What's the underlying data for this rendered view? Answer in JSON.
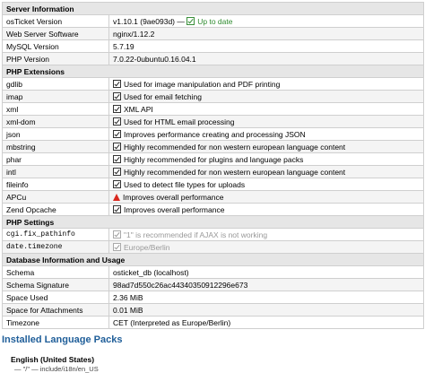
{
  "server": {
    "header": "Server Information",
    "rows": [
      {
        "label": "osTicket Version",
        "value": "v1.10.1 (9ae093d) —",
        "status": "Up to date"
      },
      {
        "label": "Web Server Software",
        "value": "nginx/1.12.2"
      },
      {
        "label": "MySQL Version",
        "value": "5.7.19"
      },
      {
        "label": "PHP Version",
        "value": "7.0.22-0ubuntu0.16.04.1"
      }
    ]
  },
  "extensions": {
    "header": "PHP Extensions",
    "rows": [
      {
        "label": "gdlib",
        "icon": "check",
        "value": "Used for image manipulation and PDF printing"
      },
      {
        "label": "imap",
        "icon": "check",
        "value": "Used for email fetching"
      },
      {
        "label": "xml",
        "icon": "check",
        "value": "XML API"
      },
      {
        "label": "xml-dom",
        "icon": "check",
        "value": "Used for HTML email processing"
      },
      {
        "label": "json",
        "icon": "check",
        "value": "Improves performance creating and processing JSON"
      },
      {
        "label": "mbstring",
        "icon": "check",
        "value": "Highly recommended for non western european language content"
      },
      {
        "label": "phar",
        "icon": "check",
        "value": "Highly recommended for plugins and language packs"
      },
      {
        "label": "intl",
        "icon": "check",
        "value": "Highly recommended for non western european language content"
      },
      {
        "label": "fileinfo",
        "icon": "check",
        "value": "Used to detect file types for uploads"
      },
      {
        "label": "APCu",
        "icon": "warning",
        "value": "Improves overall performance"
      },
      {
        "label": "Zend Opcache",
        "icon": "check",
        "value": "Improves overall performance"
      }
    ]
  },
  "settings": {
    "header": "PHP Settings",
    "rows": [
      {
        "label": "cgi.fix_pathinfo",
        "value": "\"1\" is recommended if AJAX is not working"
      },
      {
        "label": "date.timezone",
        "value": "Europe/Berlin"
      }
    ]
  },
  "database": {
    "header": "Database Information and Usage",
    "rows": [
      {
        "label": "Schema",
        "value": "osticket_db (localhost)"
      },
      {
        "label": "Schema Signature",
        "value": "98ad7d550c26ac44340350912296e673"
      },
      {
        "label": "Space Used",
        "value": "2.36 MiB"
      },
      {
        "label": "Space for Attachments",
        "value": "0.01 MiB"
      },
      {
        "label": "Timezone",
        "value": "CET (Interpreted as Europe/Berlin)"
      }
    ]
  },
  "language_packs": {
    "title": "Installed Language Packs",
    "items": [
      {
        "name": "English (United States)",
        "path": "— \"/\" — include/i18n/en_US"
      }
    ]
  },
  "colors": {
    "header_bg": "#e6e6e6",
    "ok_green": "#2e8b2e",
    "warning_red": "#d9281f",
    "heading_blue": "#1f5e99"
  }
}
